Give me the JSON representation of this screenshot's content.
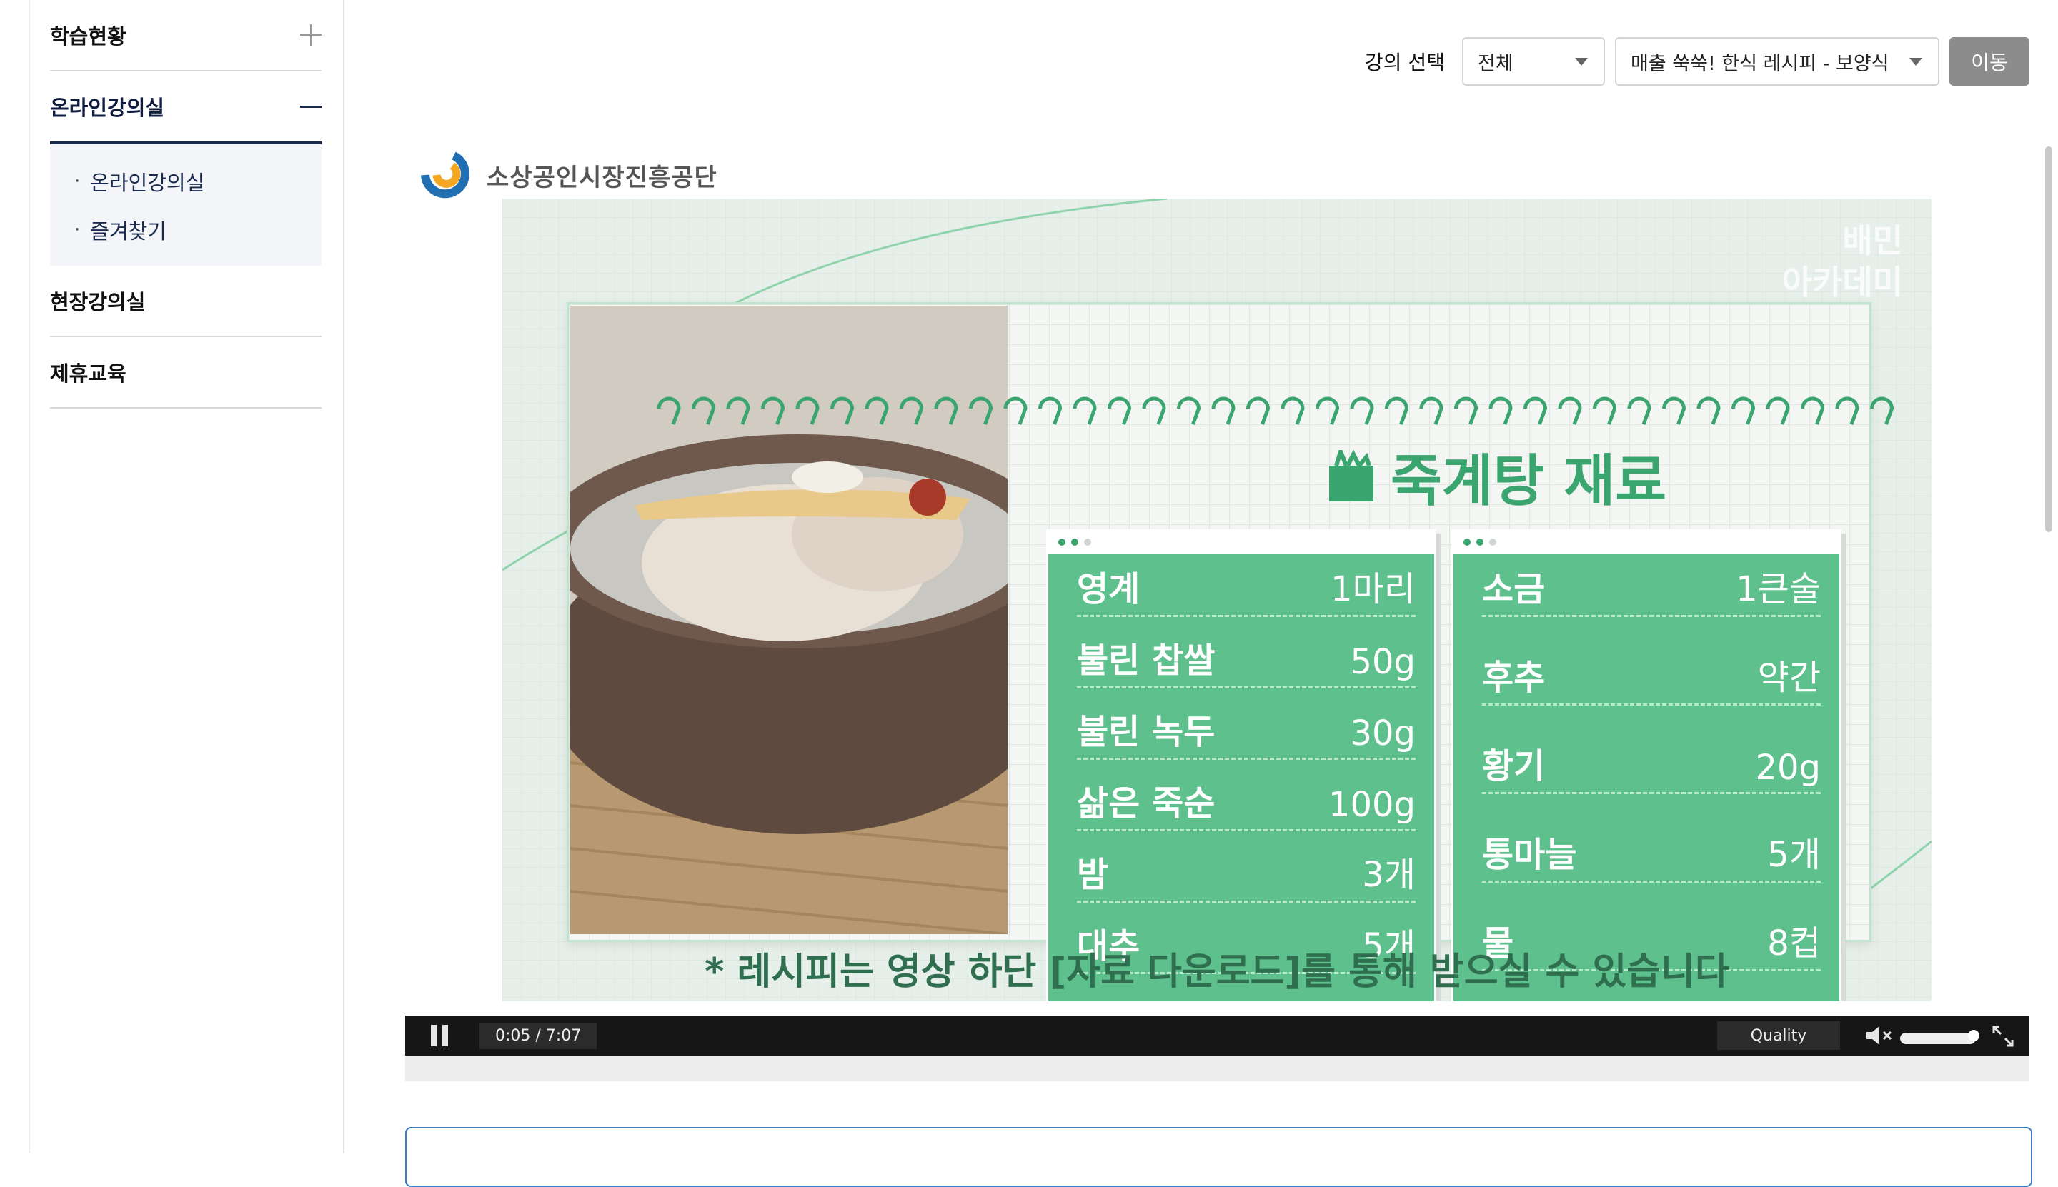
{
  "sidebar": {
    "items": [
      {
        "label": "학습현황",
        "toggle": "plus"
      },
      {
        "label": "온라인강의실",
        "toggle": "minus",
        "subitems": [
          {
            "label": "온라인강의실"
          },
          {
            "label": "즐겨찾기"
          }
        ]
      },
      {
        "label": "현장강의실"
      },
      {
        "label": "제휴교육"
      }
    ]
  },
  "controls": {
    "label": "강의 선택",
    "category_select": "전체",
    "lecture_select": "매출 쑥쑥! 한식 레시피 - 보양식",
    "go_button": "이동"
  },
  "org": {
    "name": "소상공인시장진흥공단",
    "logo_colors": [
      "#f5a623",
      "#1f6fb2"
    ]
  },
  "video": {
    "title": "죽계탕 재료",
    "watermark": [
      "배민",
      "아카데미"
    ],
    "left_panel": [
      {
        "name": "영계",
        "qty": "1마리"
      },
      {
        "name": "불린 찹쌀",
        "qty": "50g"
      },
      {
        "name": "불린 녹두",
        "qty": "30g"
      },
      {
        "name": "삶은 죽순",
        "qty": "100g"
      },
      {
        "name": "밤",
        "qty": "3개"
      },
      {
        "name": "대추",
        "qty": "5개"
      }
    ],
    "right_panel": [
      {
        "name": "소금",
        "qty": "1큰술"
      },
      {
        "name": "후추",
        "qty": "약간"
      },
      {
        "name": "황기",
        "qty": "20g"
      },
      {
        "name": "통마늘",
        "qty": "5개"
      },
      {
        "name": "물",
        "qty": "8컵"
      }
    ],
    "notice": "* 레시피는 영상 하단 [자료 다운로드]를 통해 받으실 수 있습니다",
    "accent": "#5ec08c"
  },
  "player": {
    "time": "0:05 / 7:07",
    "quality": "Quality",
    "volume_level": 1.0,
    "state": "playing"
  }
}
